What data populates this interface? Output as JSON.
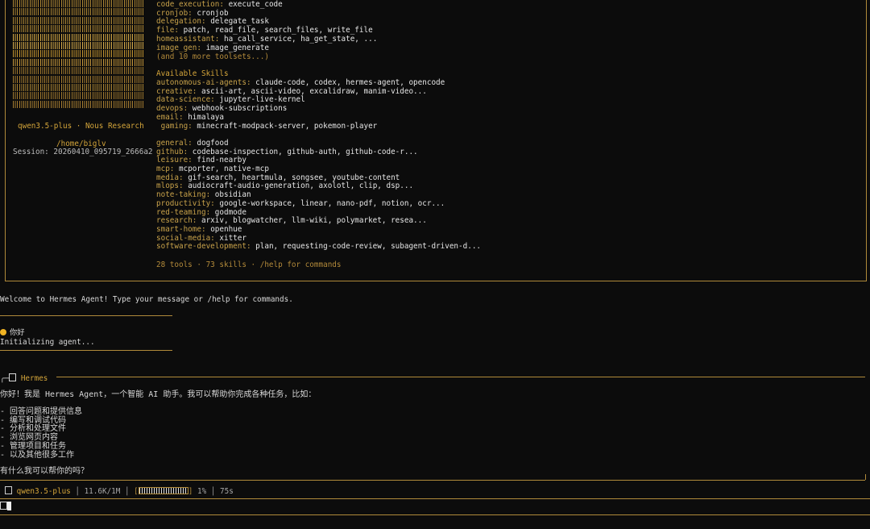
{
  "banner": {
    "model_label": "qwen3.5-plus · Nous Research",
    "cwd": "/home/biglv",
    "session": "Session: 20260410_095719_2666a2",
    "toolsets": [
      {
        "key": "code_execution:",
        "val": "execute_code"
      },
      {
        "key": "cronjob:",
        "val": "cronjob"
      },
      {
        "key": "delegation:",
        "val": "delegate_task"
      },
      {
        "key": "file:",
        "val": "patch, read_file, search_files, write_file"
      },
      {
        "key": "homeassistant:",
        "val": "ha_call_service, ha_get_state, ..."
      },
      {
        "key": "image_gen:",
        "val": "image_generate"
      }
    ],
    "more_toolsets": "(and 10 more toolsets...)",
    "skills_heading": "Available Skills",
    "skills": [
      {
        "key": "autonomous-ai-agents:",
        "val": "claude-code, codex, hermes-agent, opencode"
      },
      {
        "key": "creative:",
        "val": "ascii-art, ascii-video, excalidraw, manim-video..."
      },
      {
        "key": "data-science:",
        "val": "jupyter-live-kernel"
      },
      {
        "key": "devops:",
        "val": "webhook-subscriptions"
      },
      {
        "key": "email:",
        "val": "himalaya"
      },
      {
        "key": " gaming:",
        "val": "minecraft-modpack-server, pokemon-player"
      },
      {
        "key": "",
        "val": ""
      },
      {
        "key": "general:",
        "val": "dogfood"
      },
      {
        "key": "github:",
        "val": "codebase-inspection, github-auth, github-code-r..."
      },
      {
        "key": "leisure:",
        "val": "find-nearby"
      },
      {
        "key": "mcp:",
        "val": "mcporter, native-mcp"
      },
      {
        "key": "media:",
        "val": "gif-search, heartmula, songsee, youtube-content"
      },
      {
        "key": "mlops:",
        "val": "audiocraft-audio-generation, axolotl, clip, dsp..."
      },
      {
        "key": "note-taking:",
        "val": "obsidian"
      },
      {
        "key": "productivity:",
        "val": "google-workspace, linear, nano-pdf, notion, ocr..."
      },
      {
        "key": "red-teaming:",
        "val": "godmode"
      },
      {
        "key": "research:",
        "val": "arxiv, blogwatcher, llm-wiki, polymarket, resea..."
      },
      {
        "key": "smart-home:",
        "val": "openhue"
      },
      {
        "key": "social-media:",
        "val": "xitter"
      },
      {
        "key": "software-development:",
        "val": "plan, requesting-code-review, subagent-driven-d..."
      }
    ],
    "summary": "28 tools · 73 skills · /help for commands"
  },
  "welcome": "Welcome to Hermes Agent! Type your message or /help for commands.",
  "user_message": "你好",
  "status_init": "Initializing agent...",
  "response_header_prefix": "╭─",
  "response_header": "Hermes",
  "response": {
    "intro": "你好！我是 Hermes Agent，一个智能 AI 助手。我可以帮助你完成各种任务，比如：",
    "bullets": [
      "- 回答问题和提供信息",
      "- 编写和调试代码",
      "- 分析和处理文件",
      "- 浏览网页内容",
      "- 管理项目和任务",
      "- 以及其他很多工作"
    ],
    "question": "有什么我可以帮你的吗？"
  },
  "statusbar": {
    "model": "qwen3.5-plus",
    "tokens": "│ 11.6K/1M │",
    "percent": "1%",
    "time": "│ 75s"
  },
  "colors": {
    "accent": "#d4a53a",
    "background": "#0c0c0c",
    "text": "#d8d8d8"
  }
}
